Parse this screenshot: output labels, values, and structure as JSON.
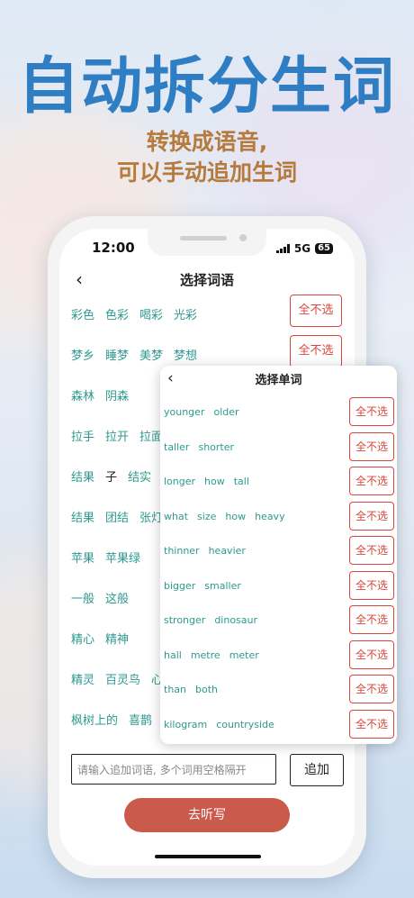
{
  "promo": {
    "headline": "自动拆分生词",
    "subline1": "转换成语音,",
    "subline2": "可以手动追加生词"
  },
  "status_bar": {
    "time": "12:00",
    "network": "5G",
    "battery": "65"
  },
  "main": {
    "title": "选择词语",
    "rows": [
      {
        "words": [
          "彩色",
          "色彩",
          "喝彩",
          "光彩"
        ],
        "button": "全不选"
      },
      {
        "words": [
          "梦乡",
          "睡梦",
          "美梦",
          "梦想"
        ],
        "button": "全不选"
      },
      {
        "words": [
          "森林",
          "阴森"
        ]
      },
      {
        "words": [
          "拉手",
          "拉开",
          "拉面"
        ]
      },
      {
        "words": [
          "结果",
          "子",
          "结实"
        ]
      },
      {
        "words": [
          "结果",
          "团结",
          "张灯"
        ]
      },
      {
        "words": [
          "苹果",
          "苹果绿"
        ]
      },
      {
        "words": [
          "一般",
          "这般"
        ]
      },
      {
        "words": [
          "精心",
          "精神"
        ]
      },
      {
        "words": [
          "精灵",
          "百灵鸟",
          "心"
        ]
      },
      {
        "words": [
          "枫树上的",
          "喜鹊"
        ]
      }
    ],
    "input_placeholder": "请输入追加词语, 多个词用空格隔开",
    "add_label": "追加",
    "go_label": "去听写"
  },
  "sheet": {
    "title": "选择单词",
    "rows": [
      {
        "words": [
          "younger",
          "older"
        ],
        "button": "全不选"
      },
      {
        "words": [
          "taller",
          "shorter"
        ],
        "button": "全不选"
      },
      {
        "words": [
          "longer",
          "how",
          "tall"
        ],
        "button": "全不选"
      },
      {
        "words": [
          "what",
          "size",
          "how",
          "heavy"
        ],
        "button": "全不选"
      },
      {
        "words": [
          "thinner",
          "heavier"
        ],
        "button": "全不选"
      },
      {
        "words": [
          "bigger",
          "smaller"
        ],
        "button": "全不选"
      },
      {
        "words": [
          "stronger",
          "dinosaur"
        ],
        "button": "全不选"
      },
      {
        "words": [
          "hall",
          "metre",
          "meter"
        ],
        "button": "全不选"
      },
      {
        "words": [
          "than",
          "both"
        ],
        "button": "全不选"
      },
      {
        "words": [
          "kilogram",
          "countryside"
        ],
        "button": "全不选"
      }
    ]
  },
  "colors": {
    "headline": "#2f7ec4",
    "subline": "#b57a3c",
    "word": "#2e9a8f",
    "accent_red": "#d9473c",
    "go_button": "#c95a4c"
  },
  "icons": [
    "back-chevron-icon",
    "signal-icon",
    "battery-icon"
  ]
}
